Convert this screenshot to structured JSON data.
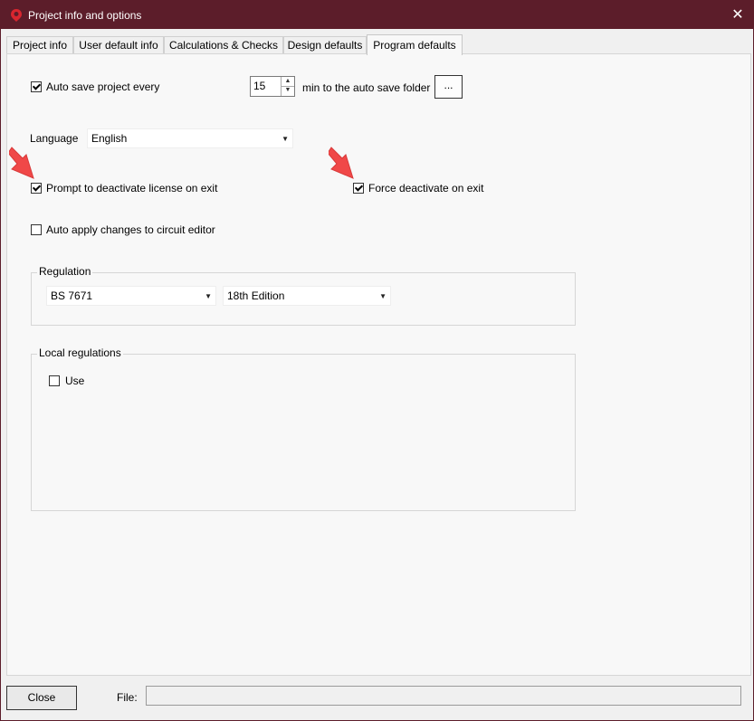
{
  "window": {
    "title": "Project info and options",
    "title_bg": "#5c1d2a",
    "close_glyph": "✕"
  },
  "tabs": [
    {
      "label": "Project info"
    },
    {
      "label": "User default info"
    },
    {
      "label": "Calculations & Checks"
    },
    {
      "label": "Design defaults"
    },
    {
      "label": "Program defaults",
      "active": true
    }
  ],
  "autosave": {
    "label": "Auto save project every",
    "checked": true,
    "minutes": "15",
    "suffix": "min to the auto save folder",
    "browse_label": "..."
  },
  "language": {
    "label": "Language",
    "value": "English"
  },
  "prompt_deactivate": {
    "label": "Prompt to deactivate license on exit",
    "checked": true
  },
  "force_deactivate": {
    "label": "Force deactivate on exit",
    "checked": true
  },
  "auto_apply": {
    "label": "Auto apply changes to circuit editor",
    "checked": false
  },
  "regulation": {
    "group_label": "Regulation",
    "standard": "BS 7671",
    "edition": "18th Edition"
  },
  "local_regulations": {
    "group_label": "Local regulations",
    "use_label": "Use",
    "use_checked": false
  },
  "footer": {
    "close_label": "Close",
    "file_label": "File:",
    "file_value": ""
  },
  "annotation_color": "#f04848"
}
